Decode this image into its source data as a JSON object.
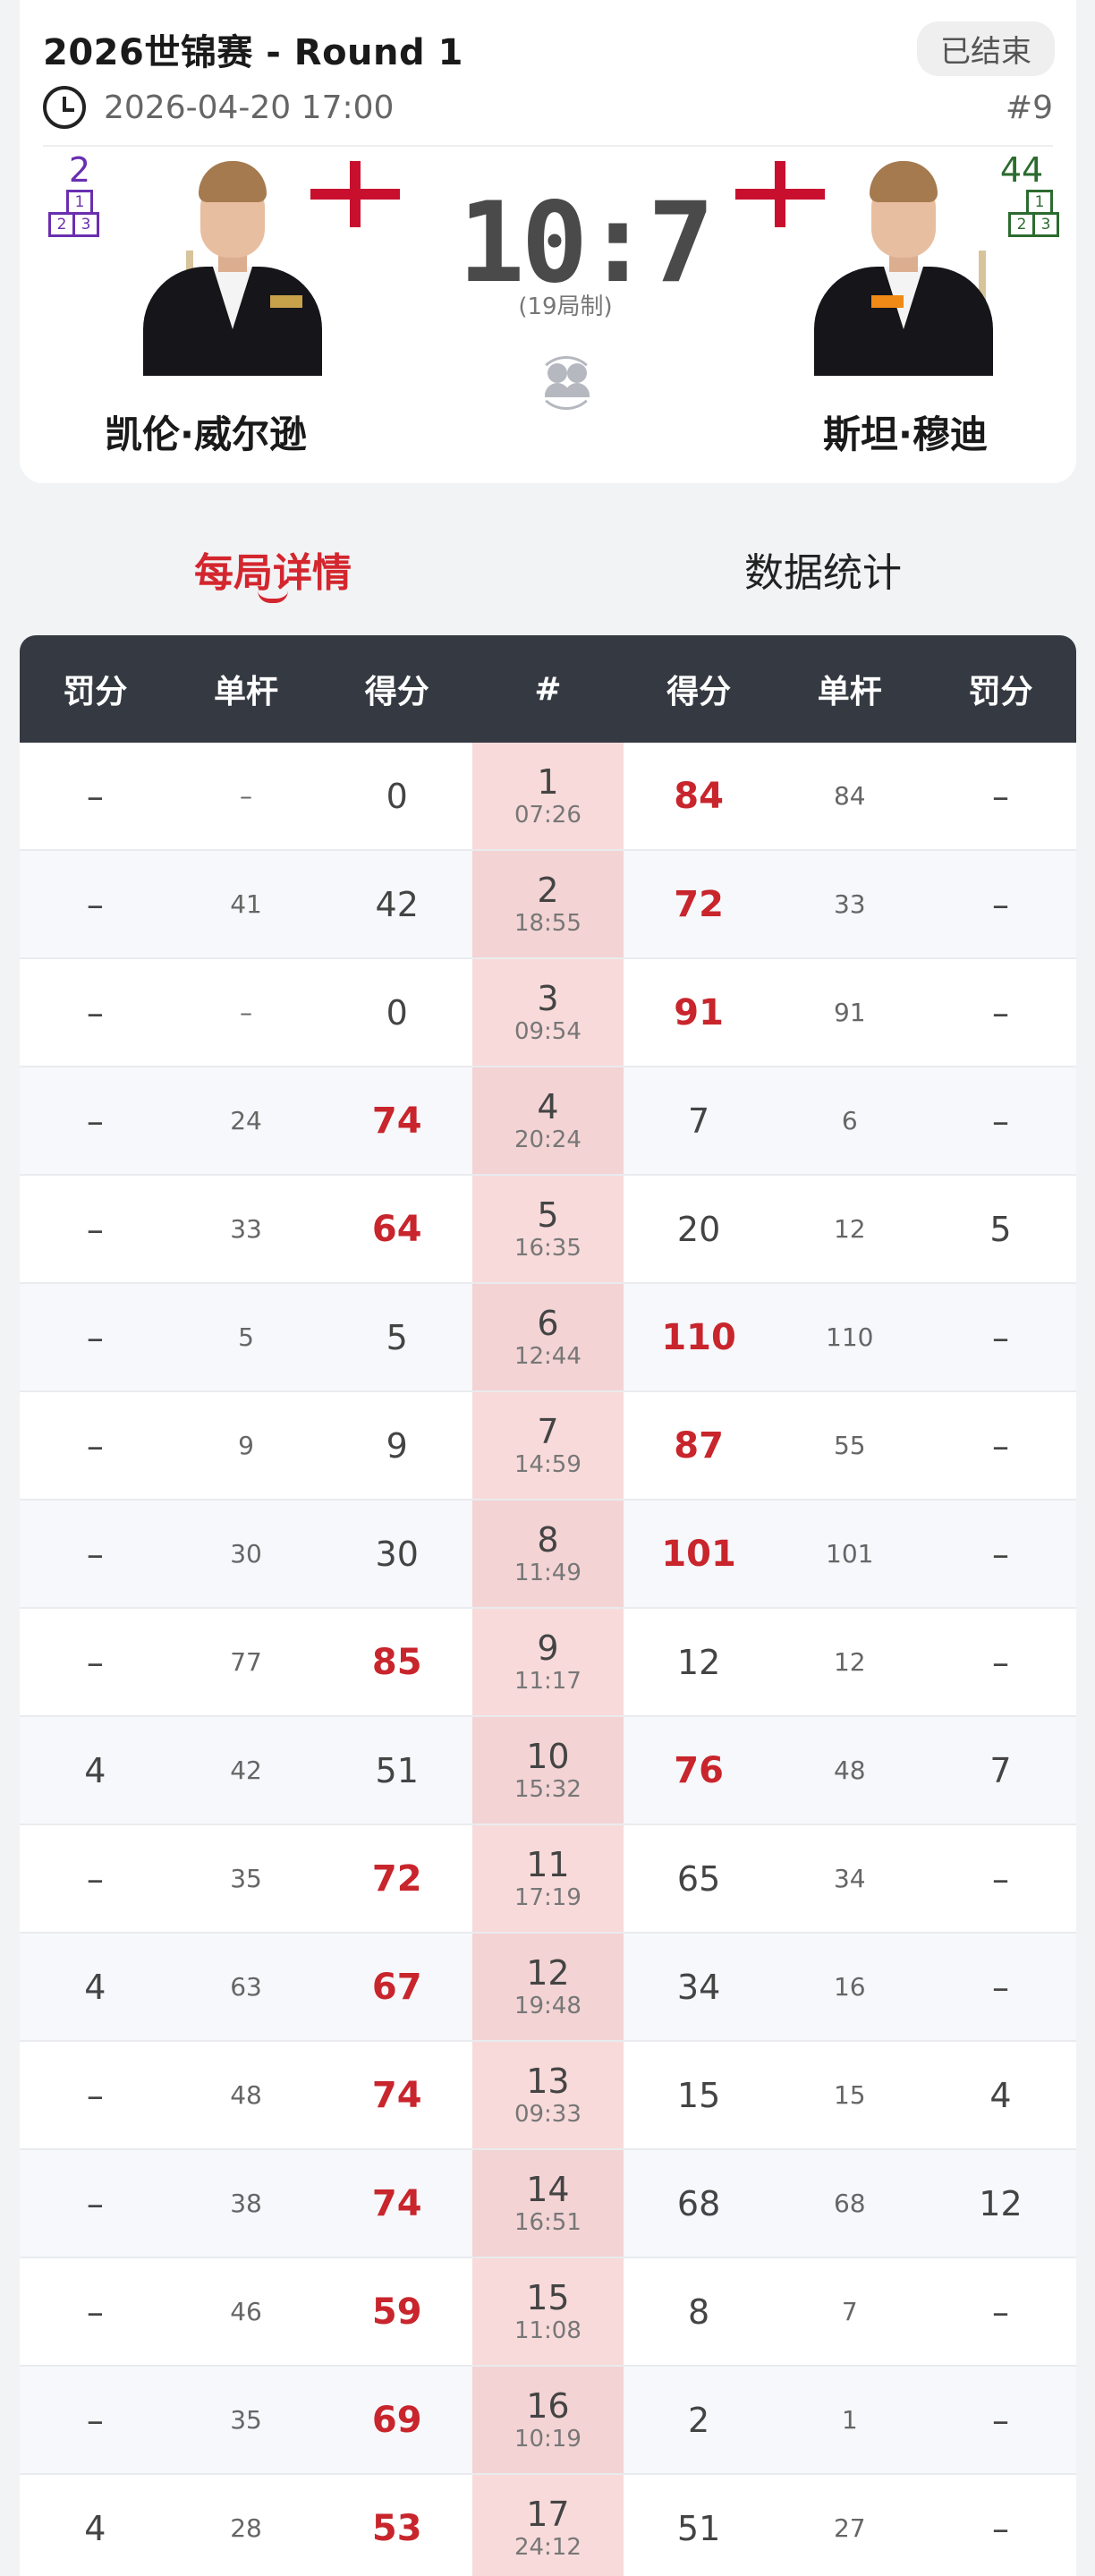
{
  "header": {
    "title": "2026世锦赛 - Round 1",
    "status": "已结束",
    "datetime": "2026-04-20 17:00",
    "match_no": "#9",
    "format": "(19局制)",
    "score": "10:7",
    "left_player": {
      "name": "凯伦·威尔逊",
      "rank": "2",
      "flag": "England"
    },
    "right_player": {
      "name": "斯坦·穆迪",
      "rank": "44",
      "flag": "England"
    }
  },
  "podium_labels": {
    "first": "1",
    "second": "2",
    "third": "3"
  },
  "tabs": {
    "active": "每局详情",
    "inactive": "数据统计"
  },
  "table": {
    "columns": [
      "罚分",
      "单杆",
      "得分",
      "#",
      "得分",
      "单杆",
      "罚分"
    ],
    "rows": [
      {
        "lp": "–",
        "lb": "–",
        "ls": "0",
        "no": "1",
        "time": "07:26",
        "rs": "84",
        "rb": "84",
        "rp": "–",
        "winner": "right"
      },
      {
        "lp": "–",
        "lb": "41",
        "ls": "42",
        "no": "2",
        "time": "18:55",
        "rs": "72",
        "rb": "33",
        "rp": "–",
        "winner": "right"
      },
      {
        "lp": "–",
        "lb": "–",
        "ls": "0",
        "no": "3",
        "time": "09:54",
        "rs": "91",
        "rb": "91",
        "rp": "–",
        "winner": "right"
      },
      {
        "lp": "–",
        "lb": "24",
        "ls": "74",
        "no": "4",
        "time": "20:24",
        "rs": "7",
        "rb": "6",
        "rp": "–",
        "winner": "left"
      },
      {
        "lp": "–",
        "lb": "33",
        "ls": "64",
        "no": "5",
        "time": "16:35",
        "rs": "20",
        "rb": "12",
        "rp": "5",
        "winner": "left"
      },
      {
        "lp": "–",
        "lb": "5",
        "ls": "5",
        "no": "6",
        "time": "12:44",
        "rs": "110",
        "rb": "110",
        "rp": "–",
        "winner": "right"
      },
      {
        "lp": "–",
        "lb": "9",
        "ls": "9",
        "no": "7",
        "time": "14:59",
        "rs": "87",
        "rb": "55",
        "rp": "–",
        "winner": "right"
      },
      {
        "lp": "–",
        "lb": "30",
        "ls": "30",
        "no": "8",
        "time": "11:49",
        "rs": "101",
        "rb": "101",
        "rp": "–",
        "winner": "right"
      },
      {
        "lp": "–",
        "lb": "77",
        "ls": "85",
        "no": "9",
        "time": "11:17",
        "rs": "12",
        "rb": "12",
        "rp": "–",
        "winner": "left"
      },
      {
        "lp": "4",
        "lb": "42",
        "ls": "51",
        "no": "10",
        "time": "15:32",
        "rs": "76",
        "rb": "48",
        "rp": "7",
        "winner": "right"
      },
      {
        "lp": "–",
        "lb": "35",
        "ls": "72",
        "no": "11",
        "time": "17:19",
        "rs": "65",
        "rb": "34",
        "rp": "–",
        "winner": "left"
      },
      {
        "lp": "4",
        "lb": "63",
        "ls": "67",
        "no": "12",
        "time": "19:48",
        "rs": "34",
        "rb": "16",
        "rp": "–",
        "winner": "left"
      },
      {
        "lp": "–",
        "lb": "48",
        "ls": "74",
        "no": "13",
        "time": "09:33",
        "rs": "15",
        "rb": "15",
        "rp": "4",
        "winner": "left"
      },
      {
        "lp": "–",
        "lb": "38",
        "ls": "74",
        "no": "14",
        "time": "16:51",
        "rs": "68",
        "rb": "68",
        "rp": "12",
        "winner": "left"
      },
      {
        "lp": "–",
        "lb": "46",
        "ls": "59",
        "no": "15",
        "time": "11:08",
        "rs": "8",
        "rb": "7",
        "rp": "–",
        "winner": "left"
      },
      {
        "lp": "–",
        "lb": "35",
        "ls": "69",
        "no": "16",
        "time": "10:19",
        "rs": "2",
        "rb": "1",
        "rp": "–",
        "winner": "left"
      },
      {
        "lp": "4",
        "lb": "28",
        "ls": "53",
        "no": "17",
        "time": "24:12",
        "rs": "51",
        "rb": "27",
        "rp": "–",
        "winner": "left"
      }
    ]
  },
  "icons": {
    "clock": "clock-icon",
    "swap": "swap-players-icon",
    "flag": "england-flag-icon",
    "podium": "ranking-podium-icon"
  },
  "colors": {
    "accent_red": "#d4262e",
    "win_red": "#c8252c",
    "table_header": "#353a42",
    "frame_col": "#f8dada",
    "rank_left": "#6a2fb0",
    "rank_right": "#2c6b2f"
  }
}
